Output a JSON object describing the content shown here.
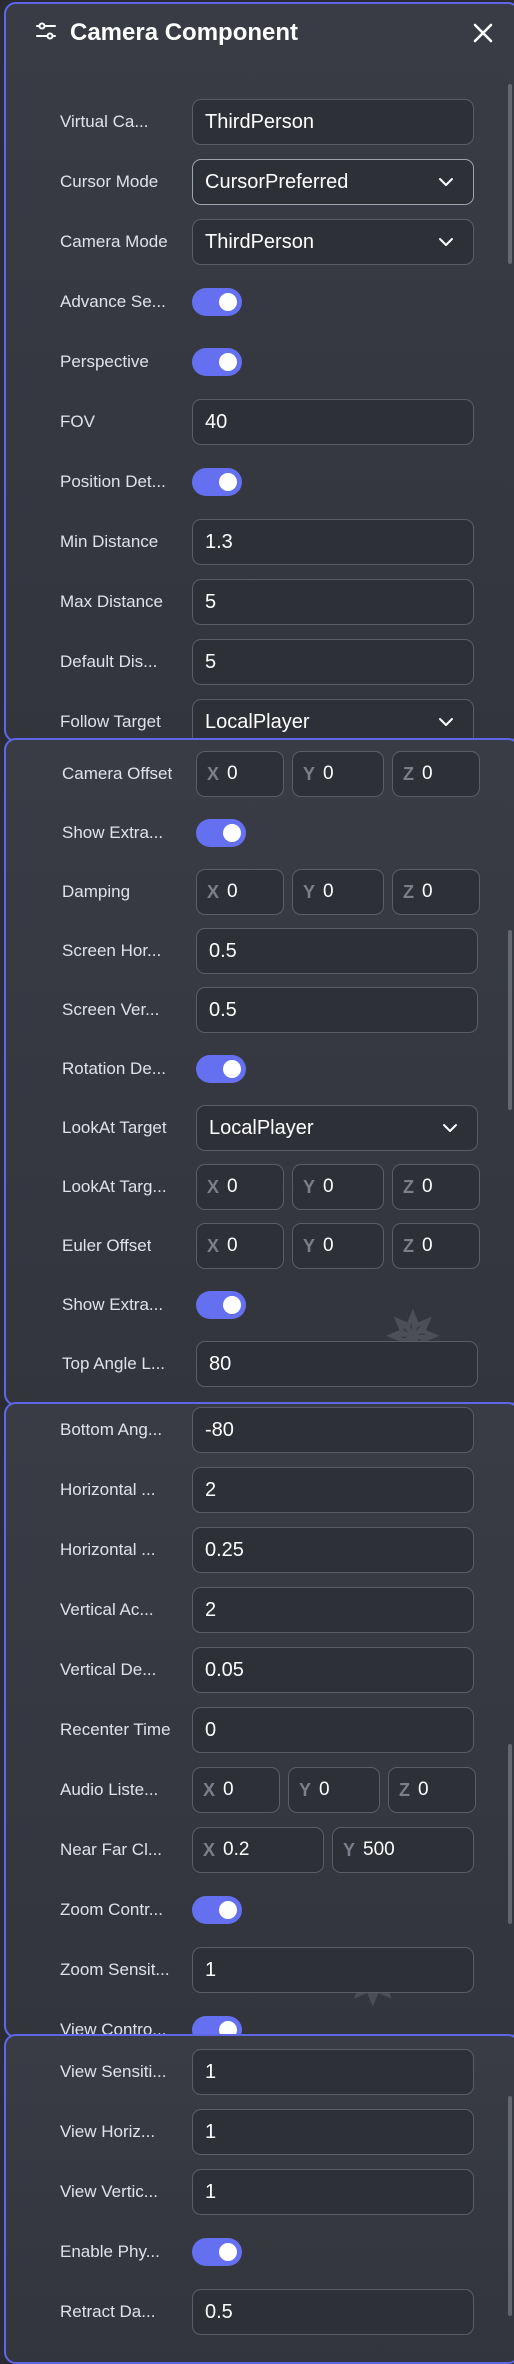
{
  "header": {
    "title": "Camera Component"
  },
  "s1": [
    {
      "type": "input",
      "label": "Virtual Ca...",
      "value": "ThirdPerson"
    },
    {
      "type": "select",
      "label": "Cursor Mode",
      "value": "CursorPreferred",
      "hl": true
    },
    {
      "type": "select",
      "label": "Camera Mode",
      "value": "ThirdPerson"
    },
    {
      "type": "toggle",
      "label": "Advance Se..."
    },
    {
      "type": "toggle",
      "label": "Perspective"
    },
    {
      "type": "input",
      "label": "FOV",
      "value": "40"
    },
    {
      "type": "toggle",
      "label": "Position Det..."
    },
    {
      "type": "input",
      "label": "Min Distance",
      "value": "1.3"
    },
    {
      "type": "input",
      "label": "Max Distance",
      "value": "5"
    },
    {
      "type": "input",
      "label": "Default Dis...",
      "value": "5"
    },
    {
      "type": "select",
      "label": "Follow Target",
      "value": "LocalPlayer"
    }
  ],
  "s2": [
    {
      "type": "vec3",
      "label": "Camera Offset",
      "x": "0",
      "y": "0",
      "z": "0"
    },
    {
      "type": "toggle",
      "label": "Show Extra..."
    },
    {
      "type": "vec3",
      "label": "Damping",
      "x": "0",
      "y": "0",
      "z": "0"
    },
    {
      "type": "input",
      "label": "Screen Hor...",
      "value": "0.5"
    },
    {
      "type": "input",
      "label": "Screen Ver...",
      "value": "0.5"
    },
    {
      "type": "toggle",
      "label": "Rotation De..."
    },
    {
      "type": "select",
      "label": "LookAt Target",
      "value": "LocalPlayer"
    },
    {
      "type": "vec3",
      "label": "LookAt Targ...",
      "x": "0",
      "y": "0",
      "z": "0"
    },
    {
      "type": "vec3",
      "label": "Euler Offset",
      "x": "0",
      "y": "0",
      "z": "0"
    },
    {
      "type": "toggle",
      "label": "Show Extra..."
    },
    {
      "type": "input",
      "label": "Top Angle L...",
      "value": "80"
    }
  ],
  "s3": [
    {
      "type": "input",
      "label": "Bottom Ang...",
      "value": "-80"
    },
    {
      "type": "input",
      "label": "Horizontal ...",
      "value": "2"
    },
    {
      "type": "input",
      "label": "Horizontal ...",
      "value": "0.25"
    },
    {
      "type": "input",
      "label": "Vertical Ac...",
      "value": "2"
    },
    {
      "type": "input",
      "label": "Vertical De...",
      "value": "0.05"
    },
    {
      "type": "input",
      "label": "Recenter Time",
      "value": "0"
    },
    {
      "type": "vec3",
      "label": "Audio Liste...",
      "x": "0",
      "y": "0",
      "z": "0"
    },
    {
      "type": "vec2",
      "label": "Near Far Cl...",
      "x": "0.2",
      "y": "500"
    },
    {
      "type": "toggle",
      "label": "Zoom Contr..."
    },
    {
      "type": "input",
      "label": "Zoom Sensit...",
      "value": "1"
    },
    {
      "type": "toggle",
      "label": "View Contro..."
    }
  ],
  "s4": [
    {
      "type": "input",
      "label": "View Sensiti...",
      "value": "1"
    },
    {
      "type": "input",
      "label": "View Horiz...",
      "value": "1"
    },
    {
      "type": "input",
      "label": "View Vertic...",
      "value": "1"
    },
    {
      "type": "toggle",
      "label": "Enable Phy..."
    },
    {
      "type": "input",
      "label": "Retract Da...",
      "value": "0.5"
    }
  ],
  "axes": {
    "x": "X",
    "y": "Y",
    "z": "Z"
  },
  "colors": {
    "accent": "#6470f0",
    "border": "#5f67e6",
    "bg": "#33353d"
  }
}
